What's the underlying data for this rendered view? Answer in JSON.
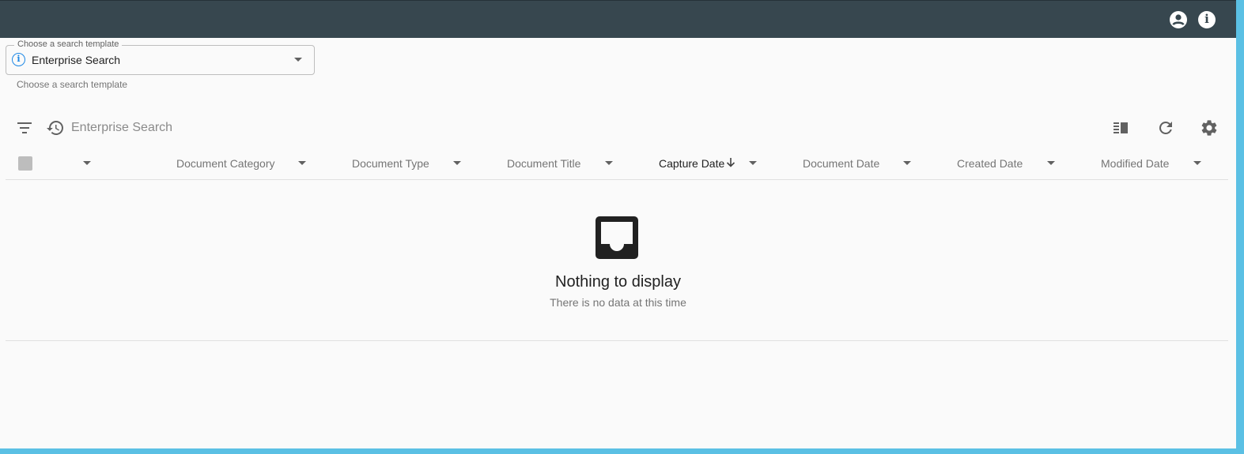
{
  "topbar": {
    "account_icon": "account-circle-icon",
    "info_icon": "info-icon"
  },
  "template": {
    "legend": "Choose a search template",
    "value": "Enterprise Search",
    "hint": "Choose a search template",
    "info_icon": "info-outline-icon",
    "info_glyph": "i"
  },
  "toolbar": {
    "search_placeholder": "Enterprise Search",
    "icons": [
      "filter-icon",
      "history-icon",
      "view-columns-icon",
      "refresh-icon",
      "gear-icon"
    ]
  },
  "table": {
    "columns": [
      {
        "label": "Document Category"
      },
      {
        "label": "Document Type"
      },
      {
        "label": "Document Title"
      },
      {
        "label": "Capture Date",
        "sort": "descending"
      },
      {
        "label": "Document Date"
      },
      {
        "label": "Created Date"
      },
      {
        "label": "Modified Date"
      }
    ]
  },
  "empty_state": {
    "icon": "inbox-icon",
    "title": "Nothing to display",
    "subtitle": "There is no data at this time"
  },
  "colors": {
    "topbar": "#37474f",
    "accent": "#1e88e5",
    "background": "#fafafa",
    "frame": "#5bc0e4"
  }
}
